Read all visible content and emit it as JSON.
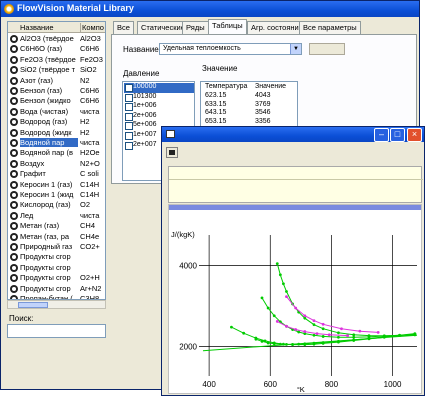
{
  "main_window": {
    "title": "FlowVision Material Library"
  },
  "materials": {
    "headers": [
      "Название",
      "Компо"
    ],
    "rows": [
      {
        "name": "Al2O3 (твёрдое",
        "formula": "Al2O3"
      },
      {
        "name": "C6H6O (газ)",
        "formula": "C6H6"
      },
      {
        "name": "Fe2O3 (твёрдое",
        "formula": "Fe2O3"
      },
      {
        "name": "SiO2 (твёрдое т",
        "formula": "SiO2"
      },
      {
        "name": "Азот (газ)",
        "formula": "N2"
      },
      {
        "name": "Бензол (газ)",
        "formula": "C6H6"
      },
      {
        "name": "Бензол (жидко",
        "formula": "C6H6"
      },
      {
        "name": "Вода (чистая)",
        "formula": "чиста"
      },
      {
        "name": "Водород (газ)",
        "formula": "H2"
      },
      {
        "name": "Водород (жидк",
        "formula": "H2"
      },
      {
        "name": "Водяной пар",
        "formula": "чиста"
      },
      {
        "name": "Водяной пар (в",
        "formula": "H2Oe"
      },
      {
        "name": "Воздух",
        "formula": "N2+O"
      },
      {
        "name": "Графит",
        "formula": "C soli"
      },
      {
        "name": "Керосин 1 (газ)",
        "formula": "C14H"
      },
      {
        "name": "Керосин 1 (жид",
        "formula": "C14H"
      },
      {
        "name": "Кислород (газ)",
        "formula": "O2"
      },
      {
        "name": "Лед",
        "formula": "чиста"
      },
      {
        "name": "Метан (газ)",
        "formula": "CH4"
      },
      {
        "name": "Метан (газ, ра",
        "formula": "CH4e"
      },
      {
        "name": "Природный газ",
        "formula": "CO2+"
      },
      {
        "name": "Продукты сгор",
        "formula": ""
      },
      {
        "name": "Продукты сгор",
        "formula": ""
      },
      {
        "name": "Продукты сгор",
        "formula": "O2+H"
      },
      {
        "name": "Продукты сгор",
        "formula": "Ar+N2"
      },
      {
        "name": "Пропан-бутан (",
        "formula": "C3H8"
      }
    ],
    "selected_index": 10
  },
  "search": {
    "label": "Поиск:",
    "value": ""
  },
  "tabs": [
    "Все",
    "Статические",
    "Ряды",
    "Таблицы",
    "Агр. состояние",
    "Все параметры"
  ],
  "active_tab": "Таблицы",
  "property": {
    "label": "Название",
    "selected": "Удельная теплоемкость"
  },
  "pressure": {
    "label": "Давление",
    "items": [
      "100000",
      "101300",
      "1e+006",
      "2e+006",
      "5e+006",
      "1e+007",
      "2e+007"
    ],
    "selected_index": 0
  },
  "values": {
    "label": "Значение",
    "headers": [
      "Температура",
      "Значение"
    ],
    "rows": [
      [
        "623.15",
        "4043"
      ],
      [
        "633.15",
        "3769"
      ],
      [
        "643.15",
        "3546"
      ],
      [
        "653.15",
        "3356"
      ]
    ]
  },
  "chart_data": {
    "type": "line",
    "title": "",
    "xlabel": "°K",
    "ylabel": "J/(kgK)",
    "xlim": [
      380,
      1080
    ],
    "ylim": [
      1350,
      4600
    ],
    "x_ticks": [
      400,
      600,
      800,
      1000
    ],
    "y_ticks": [
      2000,
      4000
    ],
    "series": [
      {
        "color": "#00cc00",
        "x": [
          380,
          1080
        ],
        "y": [
          1900,
          2280
        ]
      },
      {
        "color": "#00cc00",
        "x": [
          623,
          633,
          643,
          653,
          673,
          693,
          713,
          743,
          773,
          823,
          873,
          923,
          973,
          1023,
          1073
        ],
        "y": [
          4043,
          3769,
          3546,
          3356,
          3050,
          2850,
          2700,
          2540,
          2440,
          2340,
          2290,
          2270,
          2265,
          2275,
          2290
        ]
      },
      {
        "color": "#00cc00",
        "x": [
          573,
          593,
          613,
          633,
          653,
          673,
          693,
          713,
          743,
          773,
          823,
          873,
          923,
          973,
          1023,
          1073
        ],
        "y": [
          3200,
          2950,
          2760,
          2610,
          2500,
          2420,
          2360,
          2320,
          2280,
          2250,
          2230,
          2230,
          2240,
          2260,
          2280,
          2300
        ]
      },
      {
        "color": "#00cc00",
        "x": [
          473,
          513,
          553,
          583,
          613,
          643,
          673,
          713,
          743,
          773,
          823,
          873,
          923,
          973,
          1023,
          1073
        ],
        "y": [
          2480,
          2330,
          2210,
          2140,
          2090,
          2060,
          2050,
          2050,
          2060,
          2080,
          2110,
          2150,
          2190,
          2230,
          2270,
          2310
        ]
      },
      {
        "color": "#00cc00",
        "x": [
          553,
          573,
          593,
          613,
          633,
          653,
          673,
          693,
          713,
          743,
          773,
          823,
          873,
          923,
          973,
          1023,
          1073
        ],
        "y": [
          2180,
          2130,
          2090,
          2070,
          2060,
          2055,
          2055,
          2060,
          2070,
          2085,
          2100,
          2130,
          2165,
          2200,
          2240,
          2280,
          2320
        ]
      }
    ],
    "magenta_series": [
      {
        "color": "#dd33dd",
        "x": [
          653,
          683,
          713,
          743,
          773,
          833,
          893,
          953
        ],
        "y": [
          3230,
          2950,
          2760,
          2640,
          2550,
          2440,
          2380,
          2350
        ]
      },
      {
        "color": "#dd33dd",
        "x": [
          623,
          653,
          683,
          713,
          753,
          793,
          853
        ],
        "y": [
          2620,
          2500,
          2420,
          2370,
          2320,
          2290,
          2270
        ]
      }
    ]
  }
}
